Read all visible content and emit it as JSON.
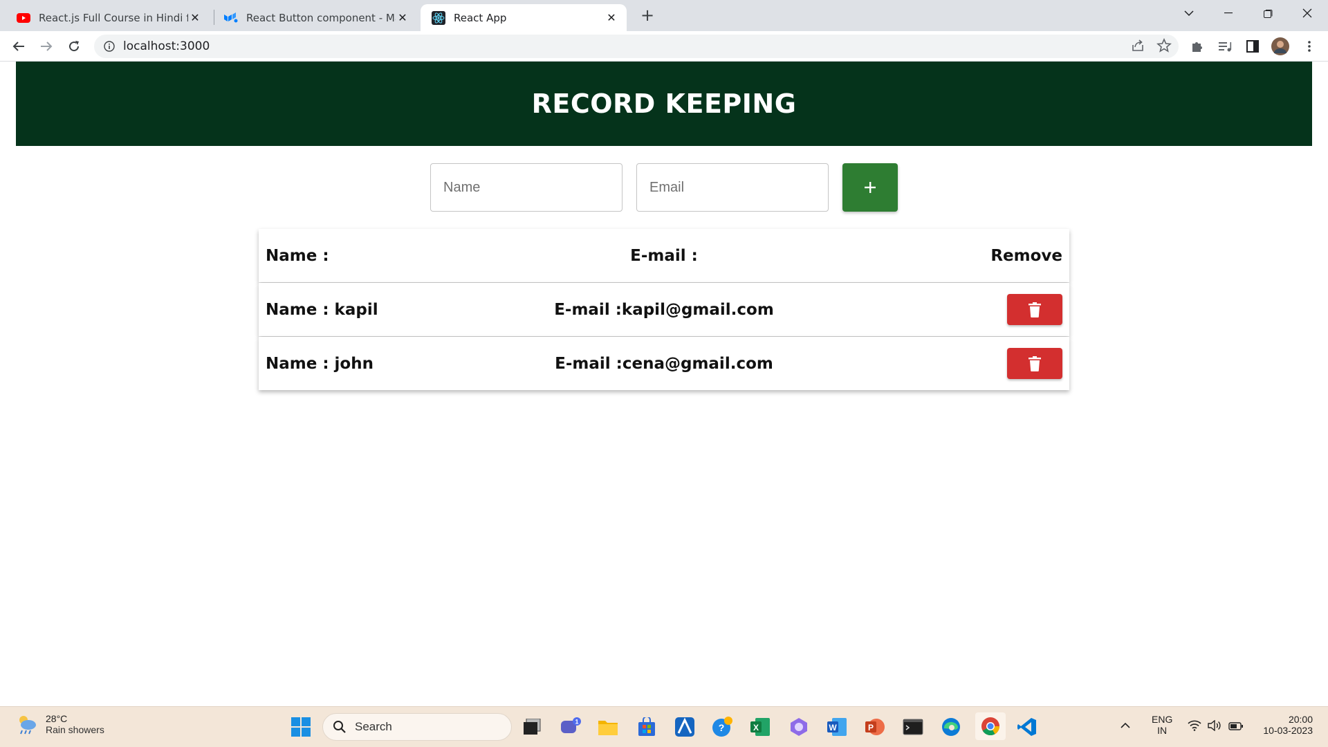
{
  "browser": {
    "tabs": [
      {
        "title": "React.js Full Course in Hindi for B",
        "icon": "youtube-icon"
      },
      {
        "title": "React Button component - Mater",
        "icon": "mui-icon"
      },
      {
        "title": "React App",
        "icon": "react-icon",
        "active": true
      }
    ],
    "url": "localhost:3000"
  },
  "app": {
    "title": "RECORD KEEPING",
    "form": {
      "name_placeholder": "Name",
      "email_placeholder": "Email",
      "add_label": "+"
    },
    "table": {
      "header": {
        "name": "Name :",
        "email": "E-mail :",
        "remove": "Remove"
      },
      "rows": [
        {
          "name": "Name : kapil",
          "email": "E-mail :kapil@gmail.com"
        },
        {
          "name": "Name : john",
          "email": "E-mail :cena@gmail.com"
        }
      ]
    }
  },
  "taskbar": {
    "weather": {
      "temp": "28°C",
      "condition": "Rain showers"
    },
    "search_label": "Search",
    "teams_badge": "1",
    "language": {
      "line1": "ENG",
      "line2": "IN"
    },
    "clock": {
      "time": "20:00",
      "date": "10-03-2023"
    }
  },
  "colors": {
    "header_bg": "#05331b",
    "add_button": "#2e7d32",
    "delete_button": "#d32f2f"
  }
}
